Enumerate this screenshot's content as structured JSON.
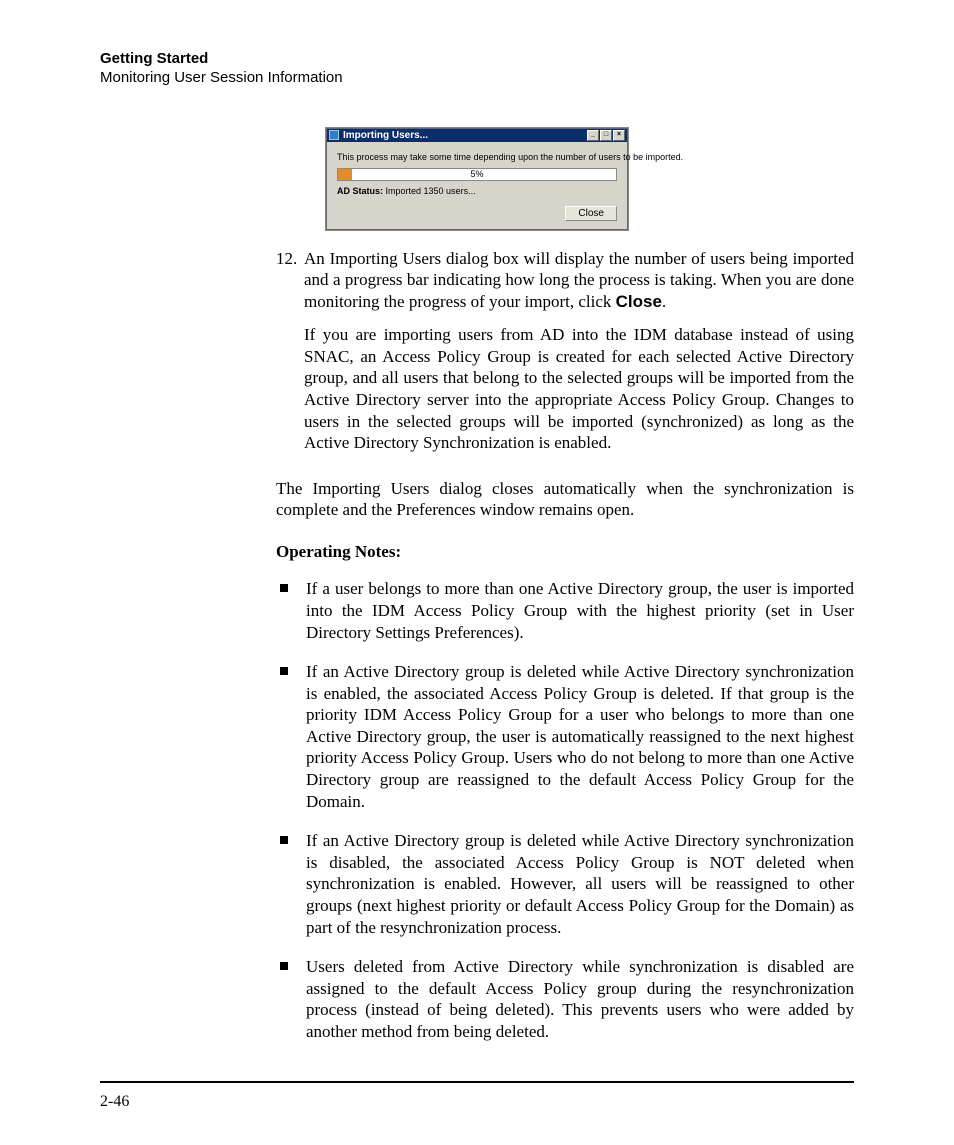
{
  "header": {
    "chapter": "Getting Started",
    "section": "Monitoring User Session Information"
  },
  "dialog": {
    "title": "Importing Users...",
    "message": "This process may take some time depending upon the number of users to be imported.",
    "progress_percent": 5,
    "progress_label": "5%",
    "status_prefix": "AD Status:",
    "status_text": " Imported 1350 users...",
    "close_label": "Close",
    "minimize_glyph": "_",
    "maximize_glyph": "□",
    "x_glyph": "×"
  },
  "body": {
    "step_number": "12.",
    "step_text_a": "An Importing Users dialog box will display the number of users being imported and a progress bar indicating how long the process is taking. When you are done monitoring the progress of your import, click ",
    "step_bold": "Close",
    "step_text_b": ".",
    "step_para2": "If you are importing users from AD into the IDM database instead of using SNAC, an Access Policy Group is created for each selected Active Directory group, and all users that belong to the selected groups will be imported from the Active Directory server into the appropriate Access Policy Group. Changes to users in the selected groups will be imported (synchronized) as long as the Active Directory Synchronization is enabled.",
    "closing_para": "The Importing Users dialog closes automatically when the synchronization is complete and the Preferences window remains open.",
    "notes_heading": "Operating Notes:",
    "bullets": [
      "If a user belongs to more than one Active Directory group, the user is imported into the IDM Access Policy Group with the highest priority (set in User Directory Settings Preferences).",
      "If an Active Directory group is deleted while Active Directory synchroni­zation is enabled, the associated Access Policy Group is deleted. If that group is the priority IDM Access Policy Group for a user who belongs to more than one Active Directory group, the user is automatically reassigned to the next highest priority Access Policy Group. Users who do not belong to more than one Active Directory group are reassigned to the default Access Policy Group for the Domain.",
      "If an Active Directory group is deleted while Active Directory synchroni­zation is disabled, the associated Access Policy Group is NOT deleted when synchronization is enabled. However, all users will be reassigned to other groups (next highest priority or default Access Policy Group for the Domain) as part of the resynchronization process.",
      "Users deleted from Active Directory while synchronization is disabled are assigned to the default Access Policy group during the resynchronization process (instead of being deleted). This prevents users who were added by another method from being deleted."
    ]
  },
  "page_number": "2-46"
}
